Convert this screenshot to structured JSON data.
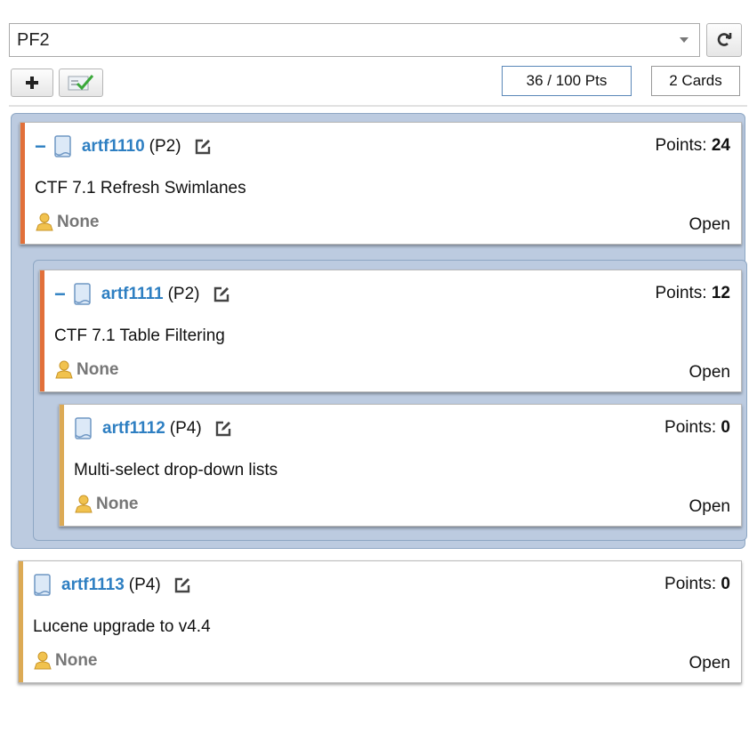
{
  "toolbar": {
    "planning_folder": "PF2",
    "points_summary": "36 / 100 Pts",
    "cards_count": "2 Cards"
  },
  "cards": [
    {
      "id": "artf1110",
      "priority": "(P2)",
      "points_label": "Points:",
      "points": "24",
      "title": "CTF 7.1 Refresh Swimlanes",
      "owner": "None",
      "status": "Open",
      "collapse": "−"
    },
    {
      "id": "artf1111",
      "priority": "(P2)",
      "points_label": "Points:",
      "points": "12",
      "title": "CTF 7.1 Table Filtering",
      "owner": "None",
      "status": "Open",
      "collapse": "−"
    },
    {
      "id": "artf1112",
      "priority": "(P4)",
      "points_label": "Points:",
      "points": "0",
      "title": "Multi-select drop-down lists",
      "owner": "None",
      "status": "Open"
    },
    {
      "id": "artf1113",
      "priority": "(P4)",
      "points_label": "Points:",
      "points": "0",
      "title": "Lucene upgrade to v4.4",
      "owner": "None",
      "status": "Open"
    }
  ],
  "colors": {
    "link": "#2e7fc2",
    "priority_high_stripe": "#e2703a",
    "priority_low_stripe": "#dcaa55",
    "group_background": "#bccbe0"
  },
  "icons": [
    "refresh-icon",
    "plus-icon",
    "checklist-icon",
    "document-icon",
    "edit-icon",
    "person-icon"
  ]
}
